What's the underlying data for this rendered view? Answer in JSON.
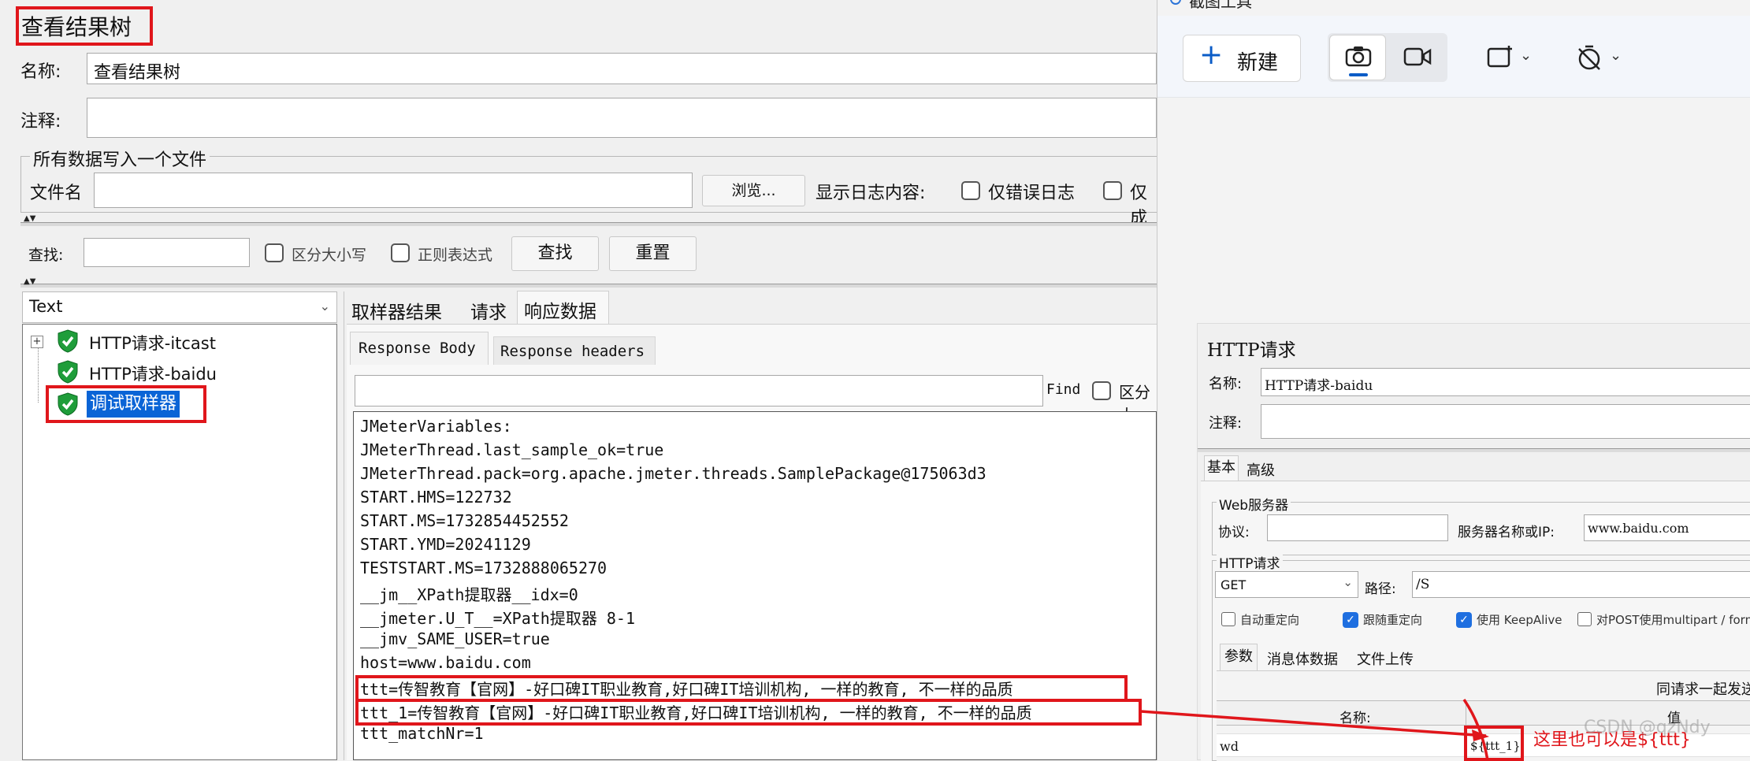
{
  "jmeter": {
    "title": "查看结果树",
    "name_label": "名称:",
    "name_value": "查看结果树",
    "comment_label": "注释:",
    "file_group_label": "所有数据写入一个文件",
    "filename_label": "文件名",
    "browse_label": "浏览...",
    "log_content_label": "显示日志内容:",
    "errors_only_label": "仅错误日志",
    "success_only_label": "仅成",
    "search_label": "查找:",
    "case_sensitive_label": "区分大小写",
    "regex_label": "正则表达式",
    "find_button": "查找",
    "reset_button": "重置",
    "renderer_value": "Text",
    "tree": [
      {
        "label": "HTTP请求-itcast"
      },
      {
        "label": "HTTP请求-baidu"
      },
      {
        "label": "调试取样器"
      }
    ],
    "result_tabs": [
      "取样器结果",
      "请求",
      "响应数据"
    ],
    "body_tabs": [
      "Response Body",
      "Response headers"
    ],
    "find_label": "Find",
    "case_label": "区分大",
    "response_lines": [
      "JMeterVariables:",
      "JMeterThread.last_sample_ok=true",
      "JMeterThread.pack=org.apache.jmeter.threads.SamplePackage@175063d3",
      "START.HMS=122732",
      "START.MS=1732854452552",
      "START.YMD=20241129",
      "TESTSTART.MS=1732888065270",
      "__jm__XPath提取器__idx=0",
      "__jmeter.U_T__=XPath提取器 8-1",
      "__jmv_SAME_USER=true",
      "host=www.baidu.com",
      "ttt=传智教育【官网】-好口碑IT职业教育,好口碑IT培训机构, 一样的教育, 不一样的品质",
      "ttt_1=传智教育【官网】-好口碑IT职业教育,好口碑IT培训机构, 一样的教育, 不一样的品质",
      "ttt_matchNr=1"
    ]
  },
  "snip": {
    "title": "截图工具",
    "new_label": "新建"
  },
  "http": {
    "title": "HTTP请求",
    "name_label": "名称:",
    "name_value": "HTTP请求-baidu",
    "comment_label": "注释:",
    "tabs": [
      "基本",
      "高级"
    ],
    "web_server_label": "Web服务器",
    "protocol_label": "协议:",
    "server_label": "服务器名称或IP:",
    "server_value": "www.baidu.com",
    "http_request_label": "HTTP请求",
    "method_value": "GET",
    "path_label": "路径:",
    "path_value": "/S",
    "auto_redirect_label": "自动重定向",
    "follow_redirect_label": "跟随重定向",
    "keepalive_label": "使用 KeepAlive",
    "multipart_label": "对POST使用multipart / form-",
    "param_tabs": [
      "参数",
      "消息体数据",
      "文件上传"
    ],
    "send_with_label": "同请求一起发送",
    "col_name": "名称:",
    "col_value": "值",
    "param_name": "wd",
    "param_value": "${ttt_1}",
    "annotation": "这里也可以是${ttt}",
    "watermark": "CSDN @qzNdy"
  },
  "colors": {
    "highlight_red": "#e0161b",
    "selection_blue": "#0a64d6",
    "checkbox_blue": "#1f6fe0"
  }
}
